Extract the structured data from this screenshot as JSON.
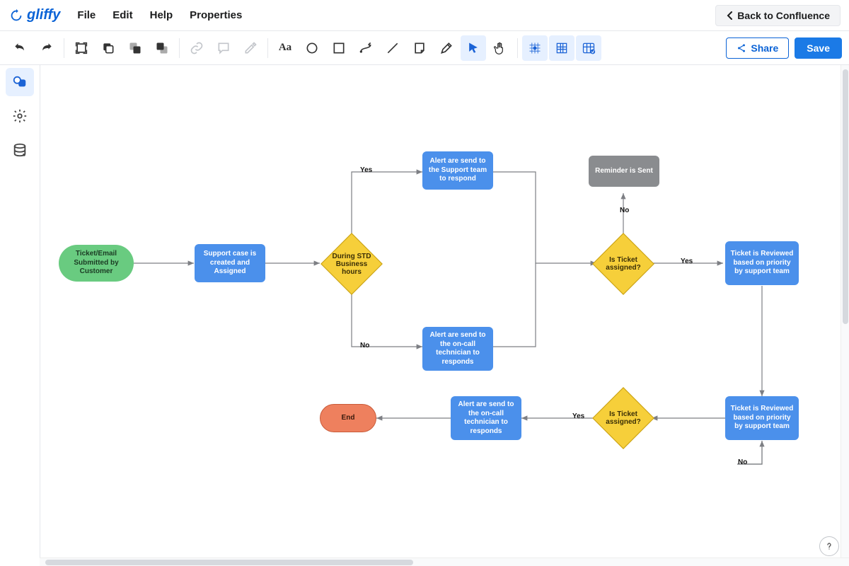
{
  "app": {
    "name": "gliffy"
  },
  "header": {
    "menu": [
      "File",
      "Edit",
      "Help",
      "Properties"
    ],
    "back_label": "Back to Confluence"
  },
  "toolbar": {
    "share_label": "Share",
    "save_label": "Save"
  },
  "diagram": {
    "nodes": {
      "start": "Ticket/Email Submitted by Customer",
      "support_case": "Support case is created and Assigned",
      "decision_hours": "During STD Business hours",
      "alert_support": "Alert are send to the Support team to respond",
      "alert_oncall": "Alert are send to the on-call technician to responds",
      "decision_assigned1": "Is Ticket assigned?",
      "reminder_sent": "Reminder is Sent",
      "review1": "Ticket is Reviewed based on priority by support team",
      "review2": "Ticket is Reviewed based on priority by support team",
      "decision_assigned2": "Is Ticket assigned?",
      "alert_oncall2": "Alert are send to the on-call technician to responds",
      "end": "End"
    },
    "edge_labels": {
      "yes": "Yes",
      "no": "No"
    }
  }
}
